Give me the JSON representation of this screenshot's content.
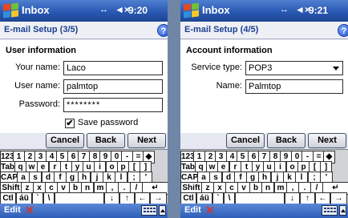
{
  "left": {
    "app_title": "Inbox",
    "signal": "↔",
    "volume": "◄×",
    "time": "9:20",
    "header": "E-mail Setup (3/5)",
    "help": "?",
    "section": "User information",
    "your_name_label": "Your name:",
    "your_name_value": "Laco",
    "user_name_label": "User name:",
    "user_name_value": "palmtop",
    "password_label": "Password:",
    "password_value": "********",
    "save_password_check": "✔",
    "save_password_label": "Save password",
    "cancel": "Cancel",
    "back": "Back",
    "next": "Next",
    "menu_edit": "Edit",
    "close": "✕"
  },
  "right": {
    "app_title": "Inbox",
    "signal": "↔",
    "volume": "◄×",
    "time": "9:21",
    "header": "E-mail Setup (4/5)",
    "help": "?",
    "section": "Account information",
    "service_type_label": "Service type:",
    "service_type_value": "POP3",
    "name_label": "Name:",
    "name_value": "Palmtop",
    "cancel": "Cancel",
    "back": "Back",
    "next": "Next",
    "menu_edit": "Edit",
    "close": "✕"
  },
  "keyboard": {
    "row1": [
      "123",
      "1",
      "2",
      "3",
      "4",
      "5",
      "6",
      "7",
      "8",
      "9",
      "0",
      "-",
      "=",
      "◆"
    ],
    "row2": [
      "Tab",
      "q",
      "w",
      "e",
      "r",
      "t",
      "y",
      "u",
      "i",
      "o",
      "p",
      "[",
      "]"
    ],
    "row3": [
      "CAP",
      "a",
      "s",
      "d",
      "f",
      "g",
      "h",
      "j",
      "k",
      "l",
      ";",
      "'"
    ],
    "row4": [
      "Shift",
      "z",
      "x",
      "c",
      "v",
      "b",
      "n",
      "m",
      ",",
      ".",
      "/",
      "↵"
    ],
    "row5": [
      "Ctl",
      "áü",
      "`",
      "\\",
      "↓",
      "↑",
      "←",
      "→"
    ]
  },
  "colors": {
    "titlebar": "#2a58b4",
    "header_text": "#1d3f8f",
    "close_x": "#d9332a",
    "background": "#6f86a6"
  },
  "icons": [
    "windows-flag-icon",
    "connectivity-icon",
    "volume-icon",
    "help-icon",
    "close-icon",
    "keyboard-icon",
    "sip-up-arrow-icon"
  ]
}
